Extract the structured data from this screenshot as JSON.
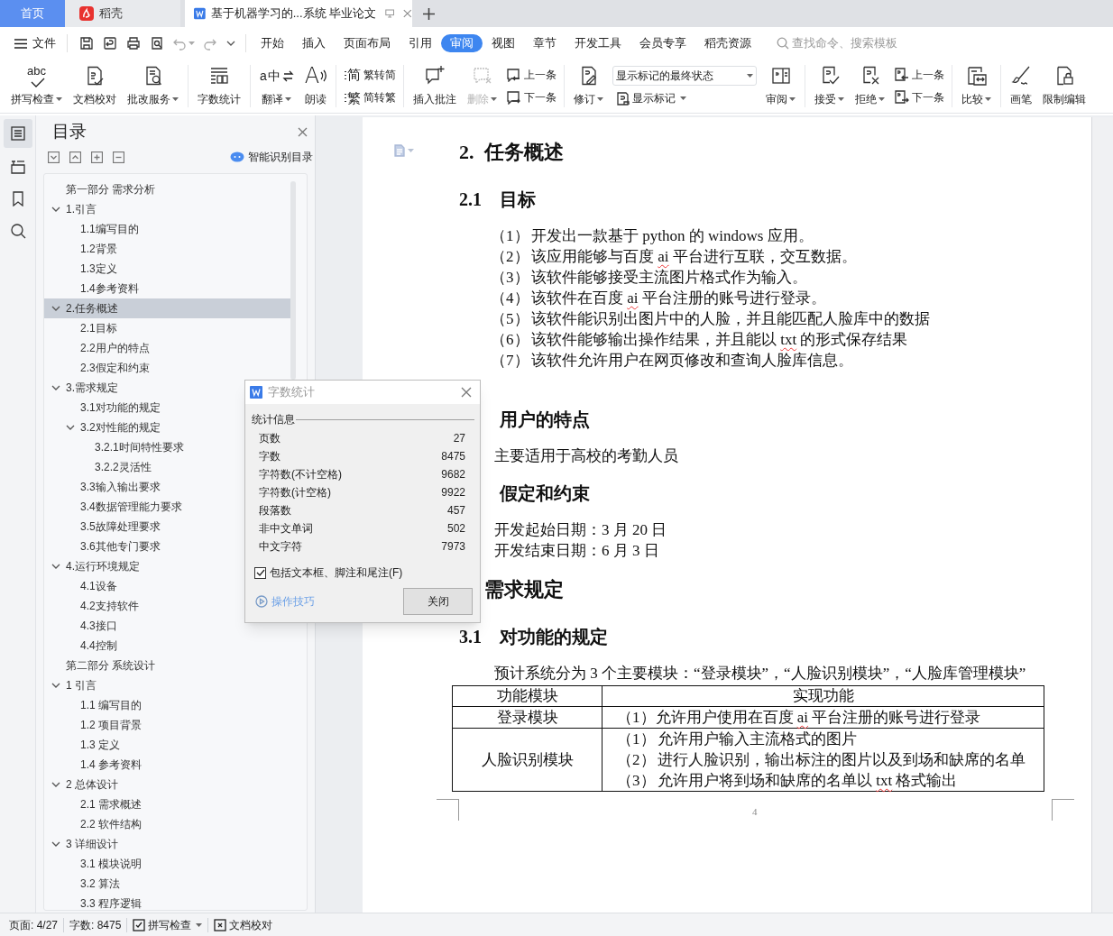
{
  "tabs": [
    {
      "label": "首页",
      "kind": "home",
      "selected": false
    },
    {
      "label": "稻壳",
      "kind": "app",
      "selected": false
    },
    {
      "label": "基于机器学习的...系统 毕业论文",
      "kind": "doc",
      "selected": true
    }
  ],
  "menu": {
    "file": "文件",
    "tabs": [
      {
        "label": "开始",
        "selected": false
      },
      {
        "label": "插入",
        "selected": false
      },
      {
        "label": "页面布局",
        "selected": false
      },
      {
        "label": "引用",
        "selected": false
      },
      {
        "label": "审阅",
        "selected": true
      },
      {
        "label": "视图",
        "selected": false
      },
      {
        "label": "章节",
        "selected": false
      },
      {
        "label": "开发工具",
        "selected": false
      },
      {
        "label": "会员专享",
        "selected": false
      },
      {
        "label": "稻壳资源",
        "selected": false
      }
    ],
    "search": {
      "placeholder": "查找命令、搜索模板"
    }
  },
  "ribbon": [
    {
      "kind": "big",
      "label": "拼写检查",
      "dropdown": true,
      "disabled": false,
      "icon_text": "abc"
    },
    {
      "kind": "big",
      "label": "文档校对",
      "dropdown": false,
      "disabled": false
    },
    {
      "kind": "big",
      "label": "批改服务",
      "dropdown": true,
      "disabled": false
    },
    {
      "kind": "sep"
    },
    {
      "kind": "big",
      "label": "字数统计",
      "dropdown": false,
      "disabled": false
    },
    {
      "kind": "sep"
    },
    {
      "kind": "big",
      "label": "翻译",
      "dropdown": true,
      "disabled": false,
      "icon_text": "a中"
    },
    {
      "kind": "big",
      "label": "朗读",
      "dropdown": false,
      "disabled": false,
      "icon_text": "A"
    },
    {
      "kind": "sep"
    },
    {
      "kind": "pair",
      "items": [
        {
          "label": "繁转简",
          "icon_text": "简"
        },
        {
          "label": "简转繁",
          "icon_text": "繁"
        }
      ]
    },
    {
      "kind": "sep"
    },
    {
      "kind": "big",
      "label": "插入批注",
      "dropdown": false,
      "disabled": false
    },
    {
      "kind": "big",
      "label": "删除",
      "dropdown": true,
      "disabled": true
    },
    {
      "kind": "pair",
      "items": [
        {
          "label": "上一条"
        },
        {
          "label": "下一条"
        }
      ]
    },
    {
      "kind": "sep"
    },
    {
      "kind": "big",
      "label": "修订",
      "dropdown": true,
      "disabled": false
    },
    {
      "kind": "select",
      "value": "显示标记的最终状态",
      "sub": {
        "label": "显示标记",
        "dropdown": true
      }
    },
    {
      "kind": "big",
      "label": "审阅",
      "dropdown": true,
      "disabled": false
    },
    {
      "kind": "sep"
    },
    {
      "kind": "big",
      "label": "接受",
      "dropdown": true,
      "disabled": false
    },
    {
      "kind": "big",
      "label": "拒绝",
      "dropdown": true,
      "disabled": false
    },
    {
      "kind": "pair",
      "items": [
        {
          "label": "上一条"
        },
        {
          "label": "下一条"
        }
      ]
    },
    {
      "kind": "sep"
    },
    {
      "kind": "big",
      "label": "比较",
      "dropdown": true,
      "disabled": false
    },
    {
      "kind": "sep"
    },
    {
      "kind": "big",
      "label": "画笔",
      "dropdown": false,
      "disabled": false
    },
    {
      "kind": "big",
      "label": "限制编辑",
      "dropdown": false,
      "disabled": false
    }
  ],
  "rail": [
    {
      "selected": true
    },
    {
      "selected": false
    },
    {
      "selected": false
    },
    {
      "selected": false
    }
  ],
  "navigation": {
    "title": "目录",
    "smart_button": "智能识别目录",
    "outline": [
      {
        "label": "第一部分  需求分析",
        "selected": false
      },
      {
        "label": "1.引言",
        "selected": false,
        "expanded": true,
        "children": [
          {
            "label": "1.1编写目的",
            "selected": false
          },
          {
            "label": "1.2背景",
            "selected": false
          },
          {
            "label": "1.3定义",
            "selected": false
          },
          {
            "label": "1.4参考资料",
            "selected": false
          }
        ]
      },
      {
        "label": "2.任务概述",
        "selected": true,
        "expanded": true,
        "children": [
          {
            "label": "2.1目标",
            "selected": false
          },
          {
            "label": "2.2用户的特点",
            "selected": false
          },
          {
            "label": "2.3假定和约束",
            "selected": false
          }
        ]
      },
      {
        "label": "3.需求规定",
        "selected": false,
        "expanded": true,
        "children": [
          {
            "label": "3.1对功能的规定",
            "selected": false
          },
          {
            "label": "3.2对性能的规定",
            "selected": false,
            "expanded": true,
            "children": [
              {
                "label": "3.2.1时间特性要求",
                "selected": false
              },
              {
                "label": "3.2.2灵活性",
                "selected": false
              }
            ]
          },
          {
            "label": "3.3输入输出要求",
            "selected": false
          },
          {
            "label": "3.4数据管理能力要求",
            "selected": false
          },
          {
            "label": "3.5故障处理要求",
            "selected": false
          },
          {
            "label": "3.6其他专门要求",
            "selected": false
          }
        ]
      },
      {
        "label": "4.运行环境规定",
        "selected": false,
        "expanded": true,
        "children": [
          {
            "label": "4.1设备",
            "selected": false
          },
          {
            "label": "4.2支持软件",
            "selected": false
          },
          {
            "label": "4.3接口",
            "selected": false
          },
          {
            "label": "4.4控制",
            "selected": false
          }
        ]
      },
      {
        "label": "第二部分  系统设计",
        "selected": false
      },
      {
        "label": "1 引言",
        "selected": false,
        "expanded": true,
        "children": [
          {
            "label": "1.1 编写目的",
            "selected": false
          },
          {
            "label": "1.2 项目背景",
            "selected": false
          },
          {
            "label": "1.3 定义",
            "selected": false
          },
          {
            "label": "1.4 参考资料",
            "selected": false
          }
        ]
      },
      {
        "label": "2 总体设计",
        "selected": false,
        "expanded": true,
        "children": [
          {
            "label": "2.1 需求概述",
            "selected": false
          },
          {
            "label": "2.2 软件结构",
            "selected": false
          }
        ]
      },
      {
        "label": "3  详细设计",
        "selected": false,
        "expanded": true,
        "children": [
          {
            "label": "3.1 模块说明",
            "selected": false
          },
          {
            "label": "3.2 算法",
            "selected": false
          },
          {
            "label": "3.3 程序逻辑",
            "selected": false
          }
        ]
      }
    ]
  },
  "document": {
    "blocks": [
      {
        "kind": "h1",
        "number": "2.",
        "title": "任务概述"
      },
      {
        "kind": "h2",
        "number": "2.1",
        "title": "目标"
      },
      {
        "kind": "list",
        "items": [
          {
            "number": "（1）",
            "parts": [
              {
                "text": "开发出一款基于 python 的 windows 应用。",
                "flagged": false
              }
            ]
          },
          {
            "number": "（2）",
            "parts": [
              {
                "text": "该应用能够与百度 ",
                "flagged": false
              },
              {
                "text": "ai",
                "flagged": true
              },
              {
                "text": " 平台进行互联，交互数据。",
                "flagged": false
              }
            ]
          },
          {
            "number": "（3）",
            "parts": [
              {
                "text": "该软件能够接受主流图片格式作为输入。",
                "flagged": false
              }
            ]
          },
          {
            "number": "（4）",
            "parts": [
              {
                "text": "该软件在百度 ",
                "flagged": false
              },
              {
                "text": "ai",
                "flagged": true
              },
              {
                "text": " 平台注册的账号进行登录。",
                "flagged": false
              }
            ]
          },
          {
            "number": "（5）",
            "parts": [
              {
                "text": "该软件能识别出图片中的人脸，并且能匹配人脸库中的数据",
                "flagged": false
              }
            ]
          },
          {
            "number": "（6）",
            "parts": [
              {
                "text": "该软件能够输出操作结果，并且能以 ",
                "flagged": false
              },
              {
                "text": "txt",
                "flagged": true
              },
              {
                "text": " 的形式保存结果",
                "flagged": false
              }
            ]
          },
          {
            "number": "（7）",
            "parts": [
              {
                "text": "该软件允许用户在网页修改和查询人脸库信息。",
                "flagged": false
              }
            ]
          }
        ]
      },
      {
        "kind": "h2",
        "title": "用户的特点"
      },
      {
        "kind": "para",
        "lines": [
          "主要适用于高校的考勤人员"
        ]
      },
      {
        "kind": "h2",
        "title": "假定和约束"
      },
      {
        "kind": "para",
        "lines": [
          "开发起始日期：3 月 20 日",
          "开发结束日期：6 月 3 日"
        ]
      },
      {
        "kind": "h1",
        "title": "需求规定"
      },
      {
        "kind": "h2",
        "number": "3.1",
        "title": "对功能的规定"
      },
      {
        "kind": "para",
        "lines": [
          "预计系统分为 3 个主要模块：“登录模块”，“人脸识别模块”，“人脸库管理模块”"
        ]
      },
      {
        "kind": "table",
        "columns": [
          "功能模块",
          "实现功能"
        ],
        "rows": [
          {
            "cells": [
              [
                {
                  "parts": [
                    {
                      "text": "登录模块",
                      "flagged": false
                    }
                  ]
                }
              ],
              [
                {
                  "parts": [
                    {
                      "text": "（1）允许用户使用在百度 ",
                      "flagged": false
                    },
                    {
                      "text": "ai",
                      "flagged": true
                    },
                    {
                      "text": " 平台注册的账号进行登录",
                      "flagged": false
                    }
                  ]
                }
              ]
            ]
          },
          {
            "cells": [
              [
                {
                  "parts": [
                    {
                      "text": "人脸识别模块",
                      "flagged": false
                    }
                  ]
                }
              ],
              [
                {
                  "number": "（1）",
                  "parts": [
                    {
                      "text": "允许用户输入主流格式的图片",
                      "flagged": false
                    }
                  ]
                },
                {
                  "number": "（2）",
                  "parts": [
                    {
                      "text": "进行人脸识别，输出标注的图片以及到场和缺席的名单",
                      "flagged": false
                    }
                  ]
                },
                {
                  "number": "（3）",
                  "parts": [
                    {
                      "text": "允许用户将到场和缺席的名单以 ",
                      "flagged": false
                    },
                    {
                      "text": "txt",
                      "flagged": true
                    },
                    {
                      "text": " 格式输出",
                      "flagged": false
                    }
                  ]
                }
              ]
            ]
          }
        ]
      }
    ],
    "page_number": "4"
  },
  "dialog": {
    "title": "字数统计",
    "section": "统计信息",
    "stats": [
      {
        "label": "页数",
        "value": "27"
      },
      {
        "label": "字数",
        "value": "8475"
      },
      {
        "label": "字符数(不计空格)",
        "value": "9682"
      },
      {
        "label": "字符数(计空格)",
        "value": "9922"
      },
      {
        "label": "段落数",
        "value": "457"
      },
      {
        "label": "非中文单词",
        "value": "502"
      },
      {
        "label": "中文字符",
        "value": "7973"
      }
    ],
    "option": {
      "label": "包括文本框、脚注和尾注(F)",
      "checked": true
    },
    "link": "操作技巧",
    "button": "关闭"
  },
  "status_bar": [
    {
      "kind": "text",
      "label": "页面: 4/27"
    },
    {
      "kind": "text",
      "label": "字数: 8475"
    },
    {
      "kind": "check",
      "label": "拼写检查",
      "dropdown": true
    },
    {
      "kind": "proof",
      "label": "文档校对",
      "dropdown": false
    }
  ]
}
